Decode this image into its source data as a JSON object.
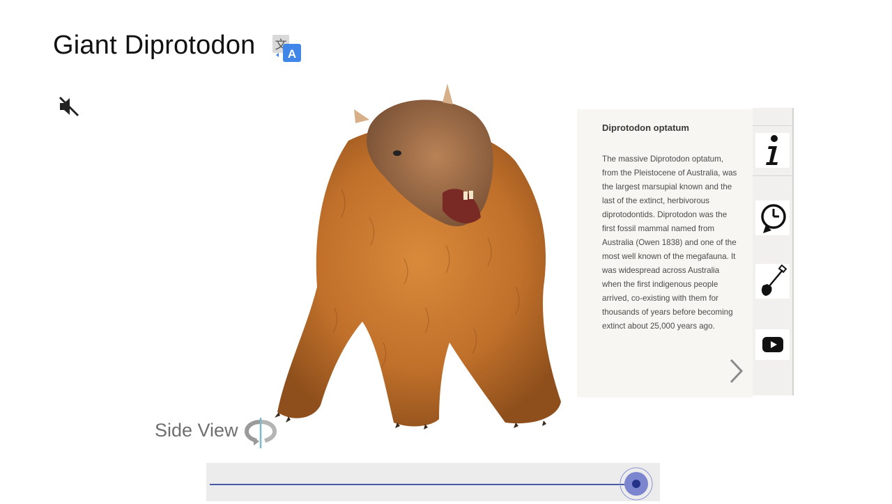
{
  "page": {
    "title": "Giant Diprotodon"
  },
  "controls": {
    "translate_icon": "translate-icon",
    "mute_icon": "speaker-muted-icon"
  },
  "info_panel": {
    "heading": "Diprotodon optatum",
    "body": "The massive Diprotodon optatum, from the Pleistocene of Australia, was the largest marsupial known and the last of the extinct, herbivorous diprotodontids. Diprotodon was the first fossil mammal named from Australia (Owen 1838) and one of the most well known of the megafauna. It was widespread across Australia when the first indigenous people arrived, co-existing with them for thousands of years before becoming extinct about 25,000 years ago.",
    "next_icon": "chevron-right-icon"
  },
  "side_toolbar": {
    "items": [
      {
        "icon": "info-icon"
      },
      {
        "icon": "history-clock-icon"
      },
      {
        "icon": "shovel-icon"
      },
      {
        "icon": "youtube-icon"
      }
    ]
  },
  "view": {
    "label": "Side View",
    "rotate_icon": "rotate-view-icon"
  },
  "slider": {
    "value_fraction": 0.97,
    "accent": "#4a5aa8"
  }
}
